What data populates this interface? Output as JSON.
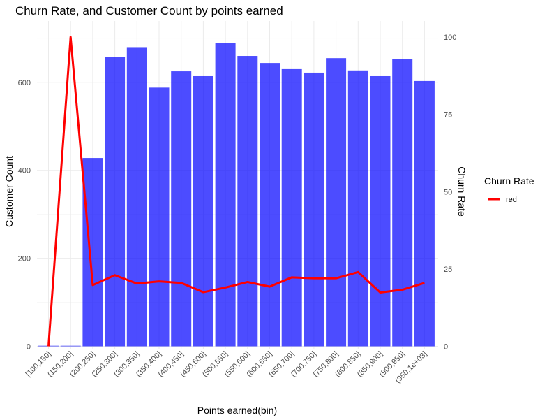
{
  "chart_data": {
    "type": "bar",
    "title": "Churn Rate, and Customer Count by points earned",
    "xlabel": "Points earned(bin)",
    "ylabel": "Customer Count",
    "y2label": "Churn Rate",
    "categories": [
      "[100,150]",
      "(150,200]",
      "(200,250]",
      "(250,300]",
      "(300,350]",
      "(350,400]",
      "(400,450]",
      "(450,500]",
      "(500,550]",
      "(550,600]",
      "(600,650]",
      "(650,700]",
      "(700,750]",
      "(750,800]",
      "(800,850]",
      "(850,900]",
      "(900,950]",
      "(950,1e+03]"
    ],
    "ylim": [
      0,
      720
    ],
    "y2lim": [
      0,
      100
    ],
    "yticks": [
      0,
      200,
      400,
      600
    ],
    "y2ticks": [
      0,
      25,
      50,
      75,
      100
    ],
    "grid": true,
    "series": [
      {
        "type": "bar",
        "color": "#0000FF",
        "values": [
          1,
          1,
          428,
          658,
          680,
          588,
          625,
          614,
          690,
          660,
          644,
          630,
          622,
          655,
          627,
          614,
          653,
          603
        ]
      },
      {
        "type": "line",
        "axis": "secondary",
        "color": "#FF0000",
        "values": [
          0,
          100,
          19.8,
          23.0,
          20.3,
          21.0,
          20.5,
          17.5,
          19.0,
          20.8,
          19.3,
          22.3,
          22.0,
          22.0,
          24.0,
          17.4,
          18.3,
          20.5
        ]
      }
    ],
    "legend": {
      "title": "Churn Rate",
      "entries": [
        "red"
      ],
      "position": "right"
    }
  }
}
